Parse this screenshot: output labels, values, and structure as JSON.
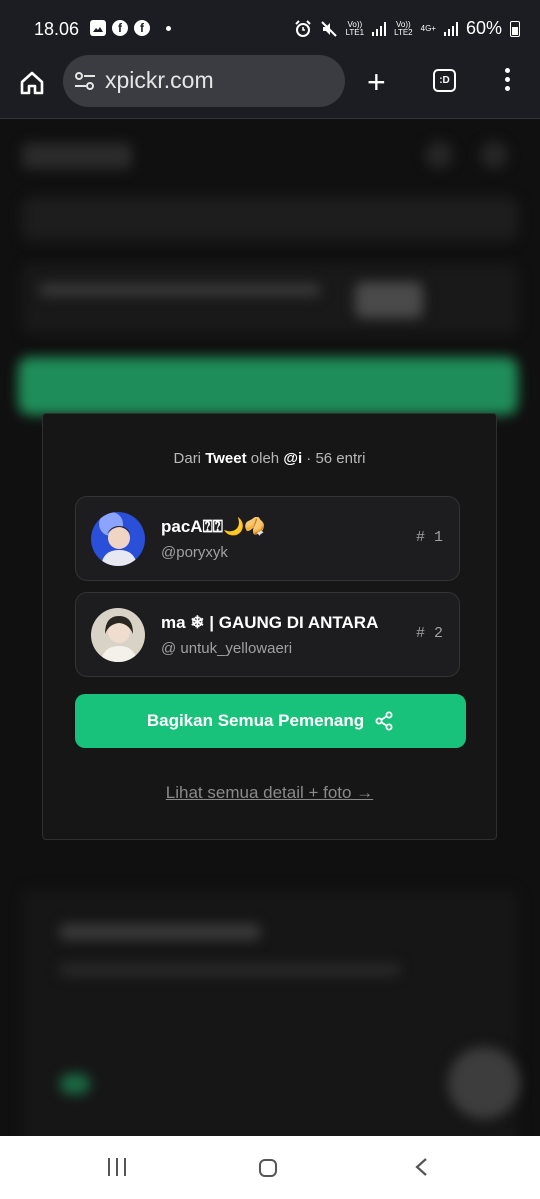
{
  "status_bar": {
    "time": "18.06",
    "volte1": "Vo))",
    "lte1": "LTE1",
    "volte2": "Vo))",
    "lte2": "LTE2",
    "network": "4G+",
    "battery": "60%"
  },
  "browser": {
    "url": "xpickr.com",
    "tabs_label": ":D"
  },
  "modal": {
    "source_prefix": "Dari",
    "source_type": "Tweet",
    "source_by": "oleh",
    "source_user": "@i",
    "entries": "· 56 entri",
    "winners": [
      {
        "name": "pacA⍰⍰🌙🥠",
        "handle": "@poryxyk",
        "rank": "# 1"
      },
      {
        "name": "ma ❄ | GAUNG DI ANTARA",
        "handle": "@ untuk_yellowaeri",
        "rank": "# 2"
      }
    ],
    "share_label": "Bagikan Semua Pemenang",
    "detail_link": "Lihat semua detail + foto →"
  },
  "icons": {
    "home": "home-icon",
    "site_info": "tune-icon",
    "new_tab": "plus-icon",
    "tab_switcher": "tabs-icon",
    "menu": "more-vert-icon",
    "share": "share-icon"
  },
  "colors": {
    "accent": "#18c27a",
    "chrome": "#1b1d22",
    "modal_bg": "#161616"
  }
}
